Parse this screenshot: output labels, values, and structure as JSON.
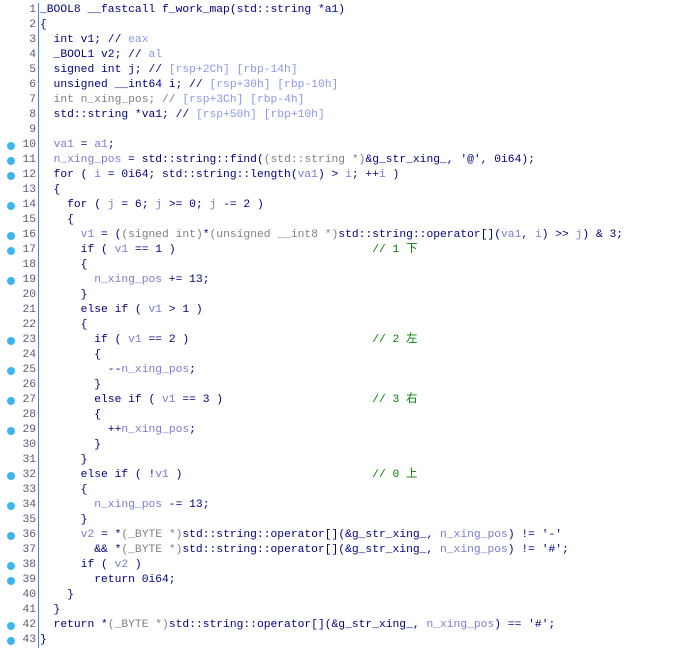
{
  "colors": {
    "keyword": "#000080",
    "variable": "#7b7bd6",
    "register_comment": "#8c96f0",
    "cast": "#808080",
    "comment": "#008000",
    "breakpoint": "#3fb4f2"
  },
  "lines": [
    {
      "n": "1",
      "dot": false,
      "seg": [
        [
          "_BOOL8 __fastcall f_work_map(std::string *a1)",
          "k"
        ]
      ]
    },
    {
      "n": "2",
      "dot": false,
      "seg": [
        [
          "{",
          "k"
        ]
      ]
    },
    {
      "n": "3",
      "dot": false,
      "seg": [
        [
          "  int v1; // ",
          "k"
        ],
        [
          "eax",
          "c"
        ]
      ]
    },
    {
      "n": "4",
      "dot": false,
      "seg": [
        [
          "  _BOOL1 v2; // ",
          "k"
        ],
        [
          "al",
          "c"
        ]
      ]
    },
    {
      "n": "5",
      "dot": false,
      "seg": [
        [
          "  signed int j; // ",
          "k"
        ],
        [
          "[rsp+2Ch] [rbp-14h]",
          "c"
        ]
      ]
    },
    {
      "n": "6",
      "dot": false,
      "seg": [
        [
          "  unsigned __int64 i; // ",
          "k"
        ],
        [
          "[rsp+30h] [rbp-10h]",
          "c"
        ]
      ]
    },
    {
      "n": "7",
      "dot": false,
      "seg": [
        [
          "  int n_xing_pos; // ",
          "g"
        ],
        [
          "[rsp+3Ch] [rbp-4h]",
          "c"
        ]
      ]
    },
    {
      "n": "8",
      "dot": false,
      "seg": [
        [
          "  std::string *va1; // ",
          "k"
        ],
        [
          "[rsp+50h] [rbp+10h]",
          "c"
        ]
      ]
    },
    {
      "n": "9",
      "dot": false,
      "seg": []
    },
    {
      "n": "10",
      "dot": true,
      "seg": [
        [
          "  ",
          "k"
        ],
        [
          "va1",
          "v"
        ],
        [
          " = ",
          "k"
        ],
        [
          "a1",
          "v"
        ],
        [
          ";",
          "k"
        ]
      ]
    },
    {
      "n": "11",
      "dot": true,
      "seg": [
        [
          "  ",
          "k"
        ],
        [
          "n_xing_pos",
          "v"
        ],
        [
          " = std::string::find(",
          "k"
        ],
        [
          "(std::string *)",
          "g"
        ],
        [
          "&g_str_xing_, '@', 0i64);",
          "k"
        ]
      ]
    },
    {
      "n": "12",
      "dot": true,
      "seg": [
        [
          "  for ( ",
          "k"
        ],
        [
          "i",
          "v"
        ],
        [
          " = 0i64; std::string::length(",
          "k"
        ],
        [
          "va1",
          "v"
        ],
        [
          ") > ",
          "k"
        ],
        [
          "i",
          "v"
        ],
        [
          "; ++",
          "k"
        ],
        [
          "i",
          "v"
        ],
        [
          " )",
          "k"
        ]
      ]
    },
    {
      "n": "13",
      "dot": false,
      "seg": [
        [
          "  {",
          "k"
        ]
      ]
    },
    {
      "n": "14",
      "dot": true,
      "seg": [
        [
          "    for ( ",
          "k"
        ],
        [
          "j",
          "v"
        ],
        [
          " = 6; ",
          "k"
        ],
        [
          "j",
          "v"
        ],
        [
          " >= 0; ",
          "k"
        ],
        [
          "j",
          "v"
        ],
        [
          " -= 2 )",
          "k"
        ]
      ]
    },
    {
      "n": "15",
      "dot": false,
      "seg": [
        [
          "    {",
          "k"
        ]
      ]
    },
    {
      "n": "16",
      "dot": true,
      "seg": [
        [
          "      ",
          "k"
        ],
        [
          "v1",
          "v"
        ],
        [
          " = (",
          "k"
        ],
        [
          "(signed int)",
          "g"
        ],
        [
          "*",
          "k"
        ],
        [
          "(unsigned __int8 *)",
          "g"
        ],
        [
          "std::string::operator[](",
          "k"
        ],
        [
          "va1",
          "v"
        ],
        [
          ", ",
          "k"
        ],
        [
          "i",
          "v"
        ],
        [
          ") >> ",
          "k"
        ],
        [
          "j",
          "v"
        ],
        [
          ") & 3;",
          "k"
        ]
      ]
    },
    {
      "n": "17",
      "dot": true,
      "seg": [
        [
          "      if ( ",
          "k"
        ],
        [
          "v1",
          "v"
        ],
        [
          " == 1 )                             ",
          "k"
        ],
        [
          "// 1 下",
          "z"
        ]
      ]
    },
    {
      "n": "18",
      "dot": false,
      "seg": [
        [
          "      {",
          "k"
        ]
      ]
    },
    {
      "n": "19",
      "dot": true,
      "seg": [
        [
          "        ",
          "k"
        ],
        [
          "n_xing_pos",
          "v"
        ],
        [
          " += 13;",
          "k"
        ]
      ]
    },
    {
      "n": "20",
      "dot": false,
      "seg": [
        [
          "      }",
          "k"
        ]
      ]
    },
    {
      "n": "21",
      "dot": false,
      "seg": [
        [
          "      else if ( ",
          "k"
        ],
        [
          "v1",
          "v"
        ],
        [
          " > 1 )",
          "k"
        ]
      ]
    },
    {
      "n": "22",
      "dot": false,
      "seg": [
        [
          "      {",
          "k"
        ]
      ]
    },
    {
      "n": "23",
      "dot": true,
      "seg": [
        [
          "        if ( ",
          "k"
        ],
        [
          "v1",
          "v"
        ],
        [
          " == 2 )                           ",
          "k"
        ],
        [
          "// 2 左",
          "z"
        ]
      ]
    },
    {
      "n": "24",
      "dot": false,
      "seg": [
        [
          "        {",
          "k"
        ]
      ]
    },
    {
      "n": "25",
      "dot": true,
      "seg": [
        [
          "          --",
          "k"
        ],
        [
          "n_xing_pos",
          "v"
        ],
        [
          ";",
          "k"
        ]
      ]
    },
    {
      "n": "26",
      "dot": false,
      "seg": [
        [
          "        }",
          "k"
        ]
      ]
    },
    {
      "n": "27",
      "dot": true,
      "seg": [
        [
          "        else if ( ",
          "k"
        ],
        [
          "v1",
          "v"
        ],
        [
          " == 3 )                      ",
          "k"
        ],
        [
          "// 3 右",
          "z"
        ]
      ]
    },
    {
      "n": "28",
      "dot": false,
      "seg": [
        [
          "        {",
          "k"
        ]
      ]
    },
    {
      "n": "29",
      "dot": true,
      "seg": [
        [
          "          ++",
          "k"
        ],
        [
          "n_xing_pos",
          "v"
        ],
        [
          ";",
          "k"
        ]
      ]
    },
    {
      "n": "30",
      "dot": false,
      "seg": [
        [
          "        }",
          "k"
        ]
      ]
    },
    {
      "n": "31",
      "dot": false,
      "seg": [
        [
          "      }",
          "k"
        ]
      ]
    },
    {
      "n": "32",
      "dot": true,
      "seg": [
        [
          "      else if ( !",
          "k"
        ],
        [
          "v1",
          "v"
        ],
        [
          " )                            ",
          "k"
        ],
        [
          "// 0 上",
          "z"
        ]
      ]
    },
    {
      "n": "33",
      "dot": false,
      "seg": [
        [
          "      {",
          "k"
        ]
      ]
    },
    {
      "n": "34",
      "dot": true,
      "seg": [
        [
          "        ",
          "k"
        ],
        [
          "n_xing_pos",
          "v"
        ],
        [
          " -= 13;",
          "k"
        ]
      ]
    },
    {
      "n": "35",
      "dot": false,
      "seg": [
        [
          "      }",
          "k"
        ]
      ]
    },
    {
      "n": "36",
      "dot": true,
      "seg": [
        [
          "      ",
          "k"
        ],
        [
          "v2",
          "v"
        ],
        [
          " = *",
          "k"
        ],
        [
          "(_BYTE *)",
          "g"
        ],
        [
          "std::string::operator[](&g_str_xing_, ",
          "k"
        ],
        [
          "n_xing_pos",
          "v"
        ],
        [
          ") != '-'",
          "k"
        ]
      ]
    },
    {
      "n": "37",
      "dot": false,
      "seg": [
        [
          "        && *",
          "k"
        ],
        [
          "(_BYTE *)",
          "g"
        ],
        [
          "std::string::operator[](&g_str_xing_, ",
          "k"
        ],
        [
          "n_xing_pos",
          "v"
        ],
        [
          ") != '#';",
          "k"
        ]
      ]
    },
    {
      "n": "38",
      "dot": true,
      "seg": [
        [
          "      if ( ",
          "k"
        ],
        [
          "v2",
          "v"
        ],
        [
          " )",
          "k"
        ]
      ]
    },
    {
      "n": "39",
      "dot": true,
      "seg": [
        [
          "        return 0i64;",
          "k"
        ]
      ]
    },
    {
      "n": "40",
      "dot": false,
      "seg": [
        [
          "    }",
          "k"
        ]
      ]
    },
    {
      "n": "41",
      "dot": false,
      "seg": [
        [
          "  }",
          "k"
        ]
      ]
    },
    {
      "n": "42",
      "dot": true,
      "seg": [
        [
          "  return *",
          "k"
        ],
        [
          "(_BYTE *)",
          "g"
        ],
        [
          "std::string::operator[](&g_str_xing_, ",
          "k"
        ],
        [
          "n_xing_pos",
          "v"
        ],
        [
          ") == '#';",
          "k"
        ]
      ]
    },
    {
      "n": "43",
      "dot": true,
      "seg": [
        [
          "}",
          "k"
        ]
      ]
    }
  ]
}
